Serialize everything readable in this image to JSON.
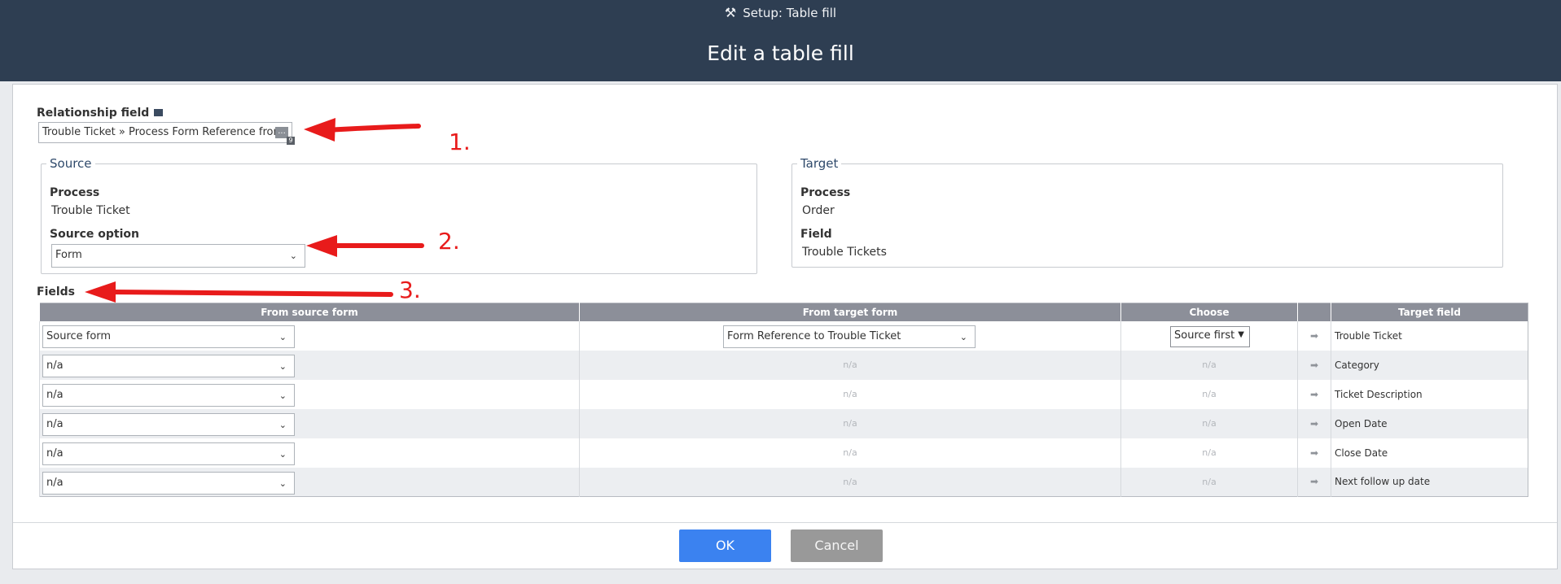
{
  "header": {
    "subtitle": "Setup: Table fill",
    "title": "Edit a table fill",
    "subtitle_icon": "tools-icon"
  },
  "relationship": {
    "label": "Relationship field",
    "value": "Trouble Ticket » Process Form Reference from",
    "picker_glyph": "...",
    "badge": "9"
  },
  "source": {
    "legend": "Source",
    "process_label": "Process",
    "process_value": "Trouble Ticket",
    "option_label": "Source option",
    "option_value": "Form"
  },
  "target": {
    "legend": "Target",
    "process_label": "Process",
    "process_value": "Order",
    "field_label": "Field",
    "field_value": "Trouble Tickets"
  },
  "fields": {
    "label": "Fields",
    "columns": [
      "From source form",
      "From target form",
      "Choose",
      "",
      "Target field"
    ],
    "rows": [
      {
        "source": "Source form",
        "target": "Form Reference to Trouble Ticket",
        "choose": "Source first",
        "field": "Trouble Ticket"
      },
      {
        "source": "n/a",
        "target": "n/a",
        "choose": "n/a",
        "field": "Category"
      },
      {
        "source": "n/a",
        "target": "n/a",
        "choose": "n/a",
        "field": "Ticket Description"
      },
      {
        "source": "n/a",
        "target": "n/a",
        "choose": "n/a",
        "field": "Open Date"
      },
      {
        "source": "n/a",
        "target": "n/a",
        "choose": "n/a",
        "field": "Close Date"
      },
      {
        "source": "n/a",
        "target": "n/a",
        "choose": "n/a",
        "field": "Next follow up date"
      }
    ]
  },
  "buttons": {
    "ok": "OK",
    "cancel": "Cancel"
  },
  "annotations": {
    "one": "1.",
    "two": "2.",
    "three": "3.",
    "color": "#e81b1b"
  }
}
